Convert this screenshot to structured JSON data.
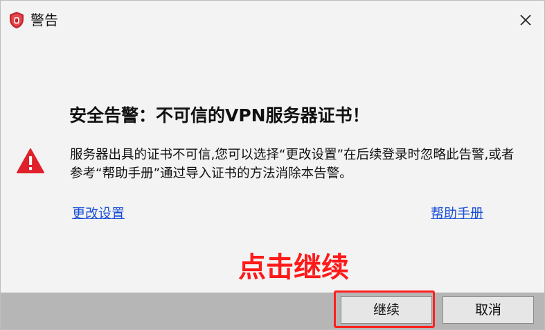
{
  "window": {
    "title": "警告",
    "app_icon": "shield-icon",
    "close_icon": "close-icon"
  },
  "alert": {
    "headline": "安全告警：不可信的VPN服务器证书！",
    "icon": "warning-triangle-icon",
    "message": "服务器出具的证书不可信,您可以选择“更改设置”在后续登录时忽略此告警,或者参考“帮助手册”通过导入证书的方法消除本告警。",
    "link_settings": "更改设置",
    "link_help": "帮助手册"
  },
  "annotation": {
    "text": "点击继续",
    "color": "#ff1a1a"
  },
  "buttons": {
    "continue_label": "继续",
    "cancel_label": "取消"
  },
  "colors": {
    "link": "#1a4fd6",
    "warning": "#e0202a",
    "highlight": "#ff2020"
  }
}
